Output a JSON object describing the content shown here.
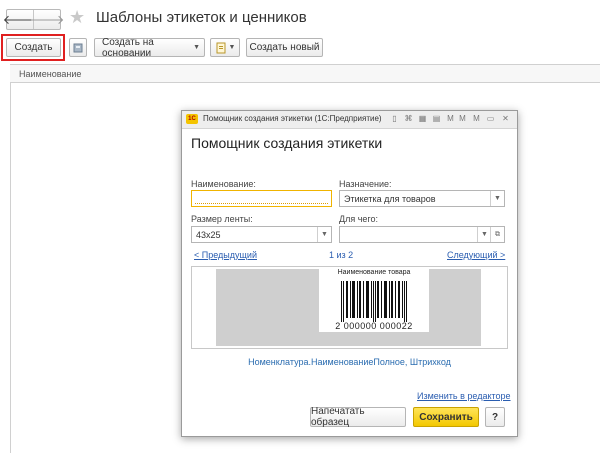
{
  "nav": {
    "back": "🡐",
    "forward": "🡒"
  },
  "window": {
    "title": "Шаблоны этикеток и ценников"
  },
  "toolbar": {
    "create_label": "Создать",
    "create_based_label": "Создать на основании",
    "create_new_label": "Создать новый"
  },
  "list": {
    "column_header": "Наименование"
  },
  "dialog": {
    "titlebar": "Помощник создания этикетки  (1С:Предприятие)",
    "heading": "Помощник создания этикетки",
    "name_label": "Наименование:",
    "name_value": "",
    "purpose_label": "Назначение:",
    "purpose_value": "Этикетка для товаров",
    "tape_label": "Размер ленты:",
    "tape_value": "43x25",
    "for_what_label": "Для чего:",
    "for_what_value": "",
    "prev_link": "< Предыдущий",
    "page_counter": "1 из 2",
    "next_link": "Следующий >",
    "preview": {
      "product_name": "Наименование товара",
      "barcode_number": "2 000000 000022"
    },
    "formula": "Номенклатура.НаименованиеПолное, Штрихкод",
    "edit_link": "Изменить в редакторе",
    "print_sample_label": "Напечатать образец",
    "save_label": "Сохранить",
    "help_label": "?"
  },
  "colors": {
    "save_button": "#f3c800",
    "highlight": "#e02020",
    "link": "#2a5db0"
  }
}
